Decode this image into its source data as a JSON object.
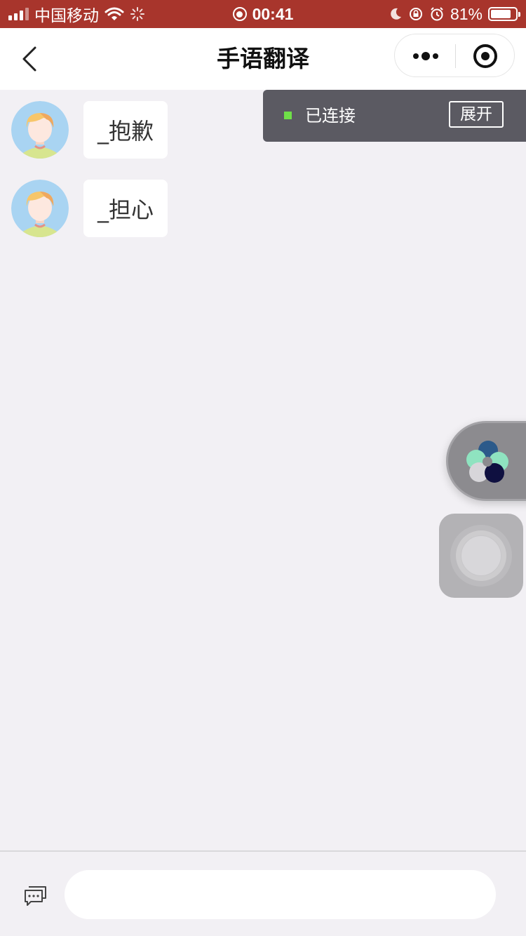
{
  "status_bar": {
    "carrier": "中国移动",
    "time": "00:41",
    "battery": "81%",
    "battery_level": 0.81
  },
  "nav": {
    "title": "手语翻译"
  },
  "messages": [
    {
      "text": "_抱歉"
    },
    {
      "text": "_担心"
    }
  ],
  "connection": {
    "status": "已连接",
    "expand_label": "展开",
    "indicator_color": "#6fe048"
  },
  "input": {
    "value": "",
    "placeholder": ""
  },
  "colors": {
    "status_bar_bg": "#a8352c",
    "page_bg": "#f2f0f4",
    "toast_bg": "#5b5a62"
  }
}
